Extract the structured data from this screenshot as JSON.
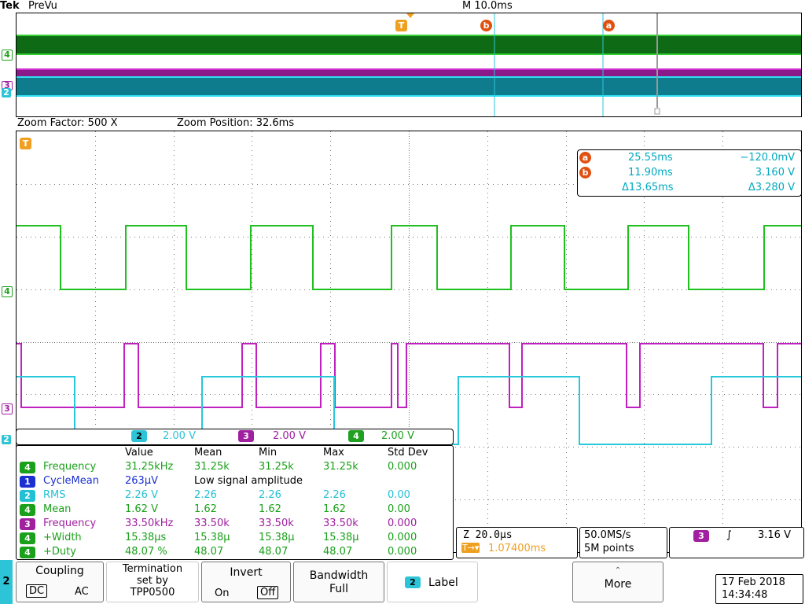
{
  "header": {
    "logo": "Tek",
    "status": "PreVu",
    "timebase": "M 10.0ms"
  },
  "overview": {
    "trigger_marker": "T",
    "cursor_a_label": "a",
    "cursor_b_label": "b",
    "channel_labels": [
      "4",
      "3",
      "2"
    ]
  },
  "zoom": {
    "factor_label": "Zoom Factor: 500 X",
    "position_label": "Zoom Position: 32.6ms"
  },
  "main": {
    "trigger_marker": "T",
    "channel_labels": [
      "4",
      "3",
      "2"
    ]
  },
  "cursor_readout": {
    "a_label": "a",
    "b_label": "b",
    "a_time": "25.55ms",
    "a_volt": "−120.0mV",
    "b_time": "11.90ms",
    "b_volt": "3.160 V",
    "delta_time": "Δ13.65ms",
    "delta_volt": "Δ3.280 V"
  },
  "channel_scales": [
    {
      "ch": "2",
      "scale": "2.00 V",
      "color": "#2ec4d8"
    },
    {
      "ch": "3",
      "scale": "2.00 V",
      "color": "#a020a0"
    },
    {
      "ch": "4",
      "scale": "2.00 V",
      "color": "#20a020"
    }
  ],
  "measurements": {
    "headers": [
      "Value",
      "Mean",
      "Min",
      "Max",
      "Std Dev"
    ],
    "rows": [
      {
        "ch": "4",
        "color": "#1aa01a",
        "name": "Frequency",
        "value": "31.25kHz",
        "mean": "31.25k",
        "min": "31.25k",
        "max": "31.25k",
        "std": "0.000"
      },
      {
        "ch": "1",
        "color": "#1a30d0",
        "name": "CycleMean",
        "value": "263µV",
        "note": "Low signal amplitude"
      },
      {
        "ch": "2",
        "color": "#22c0d4",
        "name": "RMS",
        "value": "2.26 V",
        "mean": "2.26",
        "min": "2.26",
        "max": "2.26",
        "std": "0.00"
      },
      {
        "ch": "4",
        "color": "#1aa01a",
        "name": "Mean",
        "value": "1.62 V",
        "mean": "1.62",
        "min": "1.62",
        "max": "1.62",
        "std": "0.00"
      },
      {
        "ch": "3",
        "color": "#a020a0",
        "name": "Frequency",
        "value": "33.50kHz",
        "mean": "33.50k",
        "min": "33.50k",
        "max": "33.50k",
        "std": "0.000"
      },
      {
        "ch": "4",
        "color": "#1aa01a",
        "name": "+Width",
        "value": "15.38µs",
        "mean": "15.38µ",
        "min": "15.38µ",
        "max": "15.38µ",
        "std": "0.000"
      },
      {
        "ch": "4",
        "color": "#1aa01a",
        "name": "+Duty",
        "value": "48.07 %",
        "mean": "48.07",
        "min": "48.07",
        "max": "48.07",
        "std": "0.000"
      }
    ]
  },
  "horizontal": {
    "zoom_scale": "Z 20.0µs",
    "trigger_pos": "1.07400ms",
    "trigger_icon": "T→▾"
  },
  "acquisition": {
    "sample_rate": "50.0MS/s",
    "record_length": "5M points"
  },
  "trigger": {
    "source": "3",
    "slope": "∫",
    "level": "3.16 V"
  },
  "bottom_menu": {
    "channel": "2",
    "coupling_label": "Coupling",
    "coupling_dc": "DC",
    "coupling_ac": "AC",
    "termination_line1": "Termination",
    "termination_line2": "set by",
    "termination_line3": "TPP0500",
    "invert_label": "Invert",
    "invert_on": "On",
    "invert_off": "Off",
    "bandwidth_label": "Bandwidth",
    "bandwidth_value": "Full",
    "label_channel": "2",
    "label_text": "Label",
    "more_label": "More",
    "date": "17 Feb  2018",
    "time": "14:34:48"
  },
  "colors": {
    "ch2": "#2ec4d8",
    "ch3": "#a020a0",
    "ch4": "#20b020",
    "cursor": "#e05010",
    "trigger": "#f0a020"
  }
}
